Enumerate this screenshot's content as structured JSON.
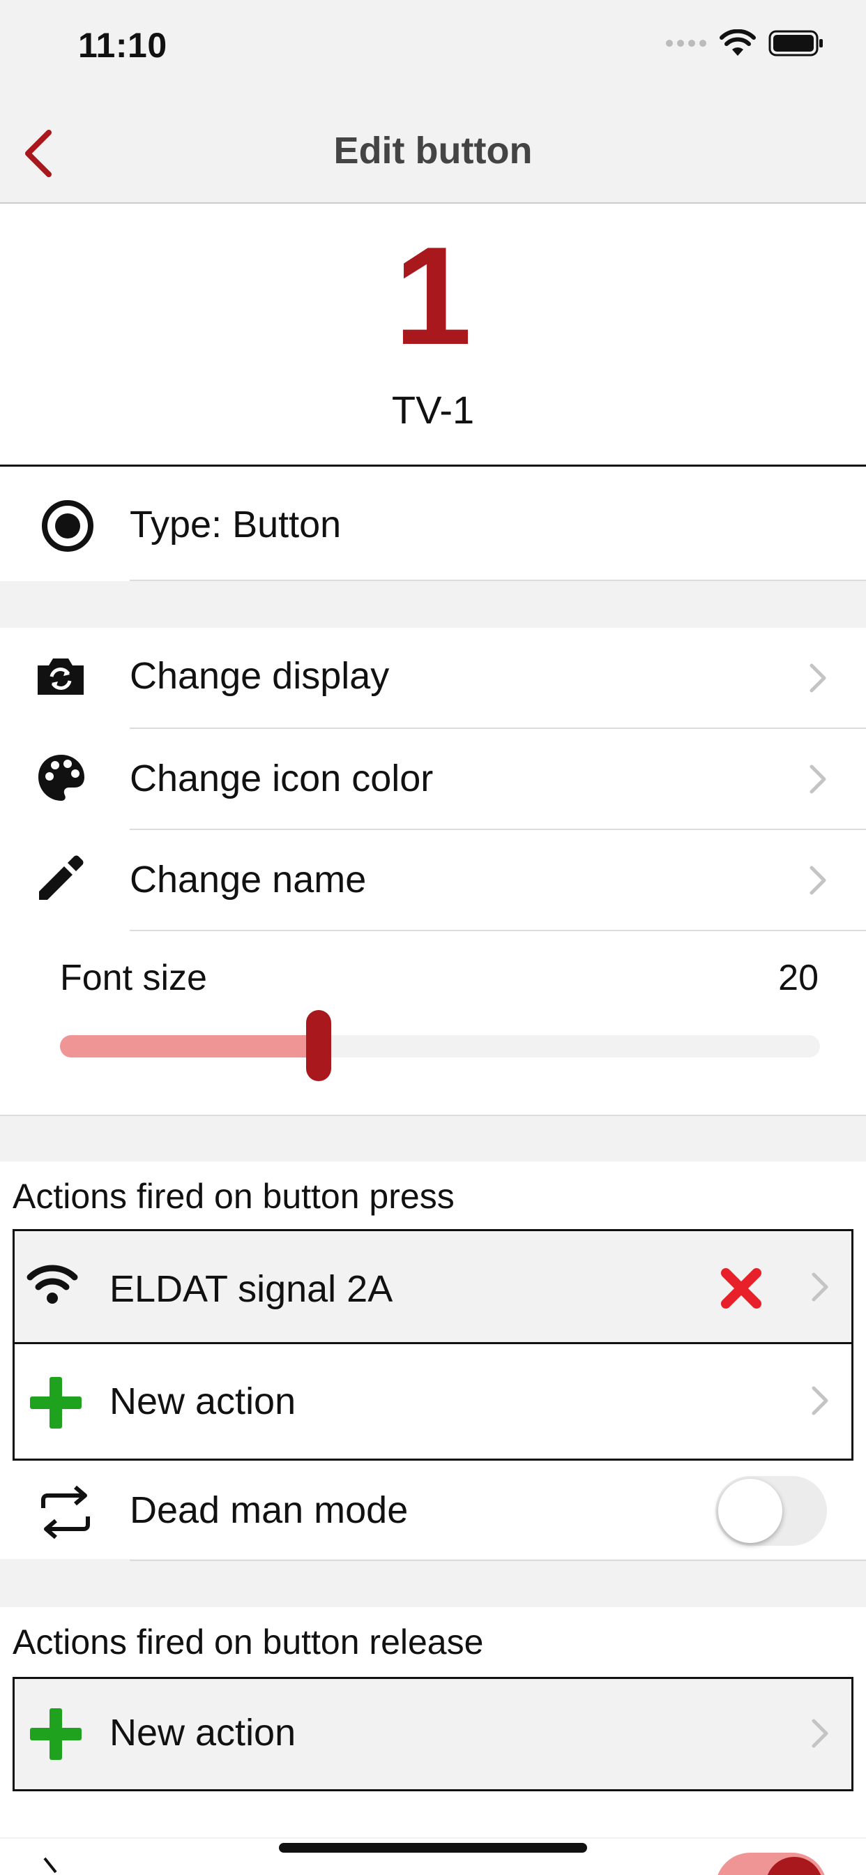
{
  "status_bar": {
    "time": "11:10"
  },
  "nav": {
    "title": "Edit button"
  },
  "header": {
    "number": "1",
    "name": "TV-1"
  },
  "type_row": {
    "label": "Type: Button"
  },
  "menu": [
    {
      "label": "Change display",
      "icon": "camera-switch-icon"
    },
    {
      "label": "Change icon color",
      "icon": "palette-icon"
    },
    {
      "label": "Change name",
      "icon": "pencil-icon"
    }
  ],
  "font_size": {
    "label": "Font size",
    "value": "20",
    "fraction": 0.34
  },
  "press_section": {
    "title": "Actions fired on button press",
    "actions": [
      {
        "label": "ELDAT signal 2A",
        "icon": "wifi-icon"
      }
    ],
    "new_action_label": "New action"
  },
  "dead_man": {
    "label": "Dead man mode",
    "enabled": false
  },
  "release_section": {
    "title": "Actions fired on button release",
    "new_action_label": "New action"
  },
  "colors": {
    "accent": "#a8181d",
    "slider_fill": "#f09595",
    "add_green": "#1fa31f",
    "delete_red": "#e8202a"
  }
}
